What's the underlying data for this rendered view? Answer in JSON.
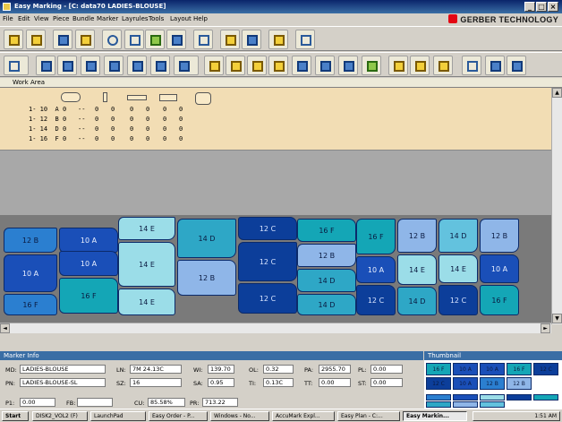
{
  "window": {
    "title": "Easy Marking - [C: data70 LADIES-BLOUSE]"
  },
  "menu": [
    "File",
    "Edit",
    "View",
    "Piece",
    "Bundle",
    "Marker",
    "Layrules",
    "Tools",
    "Layout",
    "Help"
  ],
  "brand": "GERBER TECHNOLOGY",
  "workarea": {
    "tab_label": "Work Area"
  },
  "pieces_panel": {
    "rows": [
      {
        "size": "1- 10",
        "label": "A",
        "counts": [
          "0",
          "--",
          "0",
          "0",
          "0",
          "0",
          "0",
          "0"
        ]
      },
      {
        "size": "1- 12",
        "label": "B",
        "counts": [
          "0",
          "--",
          "0",
          "0",
          "0",
          "0",
          "0",
          "0"
        ]
      },
      {
        "size": "1- 14",
        "label": "D",
        "counts": [
          "0",
          "--",
          "0",
          "0",
          "0",
          "0",
          "0",
          "0"
        ]
      },
      {
        "size": "1- 16",
        "label": "F",
        "counts": [
          "0",
          "--",
          "0",
          "0",
          "0",
          "0",
          "0",
          "0"
        ]
      }
    ]
  },
  "marker": {
    "pieces": [
      {
        "t": "12 B",
        "c": "c1"
      },
      {
        "t": "10 A",
        "c": "c2"
      },
      {
        "t": "16 F",
        "c": "c1"
      },
      {
        "t": "10 A",
        "c": "c2"
      },
      {
        "t": "10 A",
        "c": "c2"
      },
      {
        "t": "16 F",
        "c": "c8"
      },
      {
        "t": "14 E",
        "c": "c4"
      },
      {
        "t": "14 E",
        "c": "c4"
      },
      {
        "t": "14 E",
        "c": "c4"
      },
      {
        "t": "14 D",
        "c": "c5"
      },
      {
        "t": "12 B",
        "c": "c7"
      },
      {
        "t": "12 C",
        "c": "c6"
      },
      {
        "t": "12 C",
        "c": "c6"
      },
      {
        "t": "12 C",
        "c": "c6"
      },
      {
        "t": "16 F",
        "c": "c8"
      },
      {
        "t": "12 B",
        "c": "c7"
      },
      {
        "t": "14 D",
        "c": "c5"
      },
      {
        "t": "14 D",
        "c": "c5"
      },
      {
        "t": "16 F",
        "c": "c8"
      },
      {
        "t": "10 A",
        "c": "c2"
      },
      {
        "t": "12 C",
        "c": "c6"
      },
      {
        "t": "12 B",
        "c": "c7"
      },
      {
        "t": "14 E",
        "c": "c4"
      },
      {
        "t": "14 D",
        "c": "c5"
      },
      {
        "t": "14 D",
        "c": "c3"
      },
      {
        "t": "14 E",
        "c": "c4"
      },
      {
        "t": "12 C",
        "c": "c6"
      },
      {
        "t": "12 B",
        "c": "c7"
      },
      {
        "t": "10 A",
        "c": "c2"
      },
      {
        "t": "16 F",
        "c": "c8"
      }
    ]
  },
  "marker_info": {
    "title": "Marker Info",
    "labels": {
      "md": "MD:",
      "pn": "PN:",
      "ln": "LN:",
      "sz": "SZ:",
      "wi": "WI:",
      "sa": "SA:",
      "ol": "OL:",
      "ti": "TI:",
      "pa": "PA:",
      "tt": "TT:",
      "pl": "PL:",
      "st": "ST:",
      "p1": "P1:",
      "fb": "FB:",
      "cu": "CU:",
      "pr": "PR:"
    },
    "md": "LADIES-BLOUSE",
    "pn": "LADIES-BLOUSE-SL",
    "ln": "7M 24.13C",
    "sz": "16",
    "wi": "139.70",
    "sa": "0.95",
    "ol": "0.32",
    "ti": "0.13C",
    "pa": "2955.70",
    "tt": "0.00",
    "pl": "0.00",
    "st": "0.00",
    "p1": "0.00",
    "fb": "",
    "cu": "85.58%",
    "pr": "713.22"
  },
  "thumbnail": {
    "title": "Thumbnail"
  },
  "taskbar": {
    "start": "Start",
    "tasks": [
      "DISK2_VOL2 (F)",
      "LaunchPad",
      "Easy Order - P...",
      "Windows - No...",
      "AccuMark Expl...",
      "Easy Plan - C:...",
      "Easy Markin..."
    ],
    "clock": "1:51 AM"
  }
}
